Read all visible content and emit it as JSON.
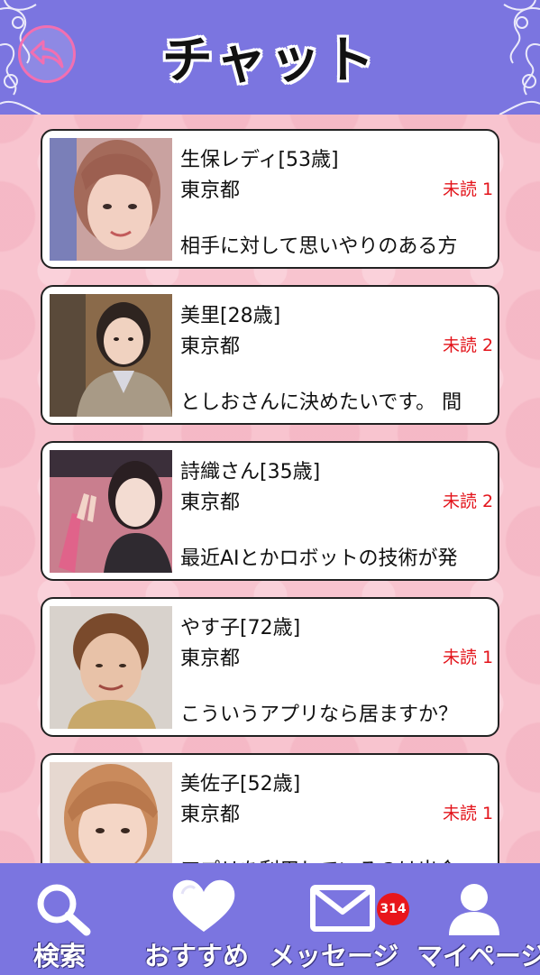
{
  "header": {
    "title": "チャット"
  },
  "chats": [
    {
      "name": "生保レディ[53歳]",
      "area": "東京都",
      "unread": "未読 1",
      "message": "相手に対して思いやりのある方"
    },
    {
      "name": "美里[28歳]",
      "area": "東京都",
      "unread": "未読 2",
      "message": "としおさんに決めたいです。 間"
    },
    {
      "name": "詩織さん[35歳]",
      "area": "東京都",
      "unread": "未読 2",
      "message": "最近AIとかロボットの技術が発"
    },
    {
      "name": "やす子[72歳]",
      "area": "東京都",
      "unread": "未読 1",
      "message": "こういうアプリなら居ますか？"
    },
    {
      "name": "美佐子[52歳]",
      "area": "東京都",
      "unread": "未読 1",
      "message": "アプリを利用しているのは出会"
    }
  ],
  "nav": {
    "search_label": "検索",
    "recommend_label": "おすすめ",
    "messages_label": "メッセージ",
    "messages_badge": "314",
    "mypage_label": "マイページ"
  },
  "colors": {
    "header_bg": "#7b75e0",
    "page_bg": "#f8c4cf",
    "unread_text": "#e3131a",
    "badge_bg": "#e8161c",
    "back_ring": "#f26fb1"
  }
}
